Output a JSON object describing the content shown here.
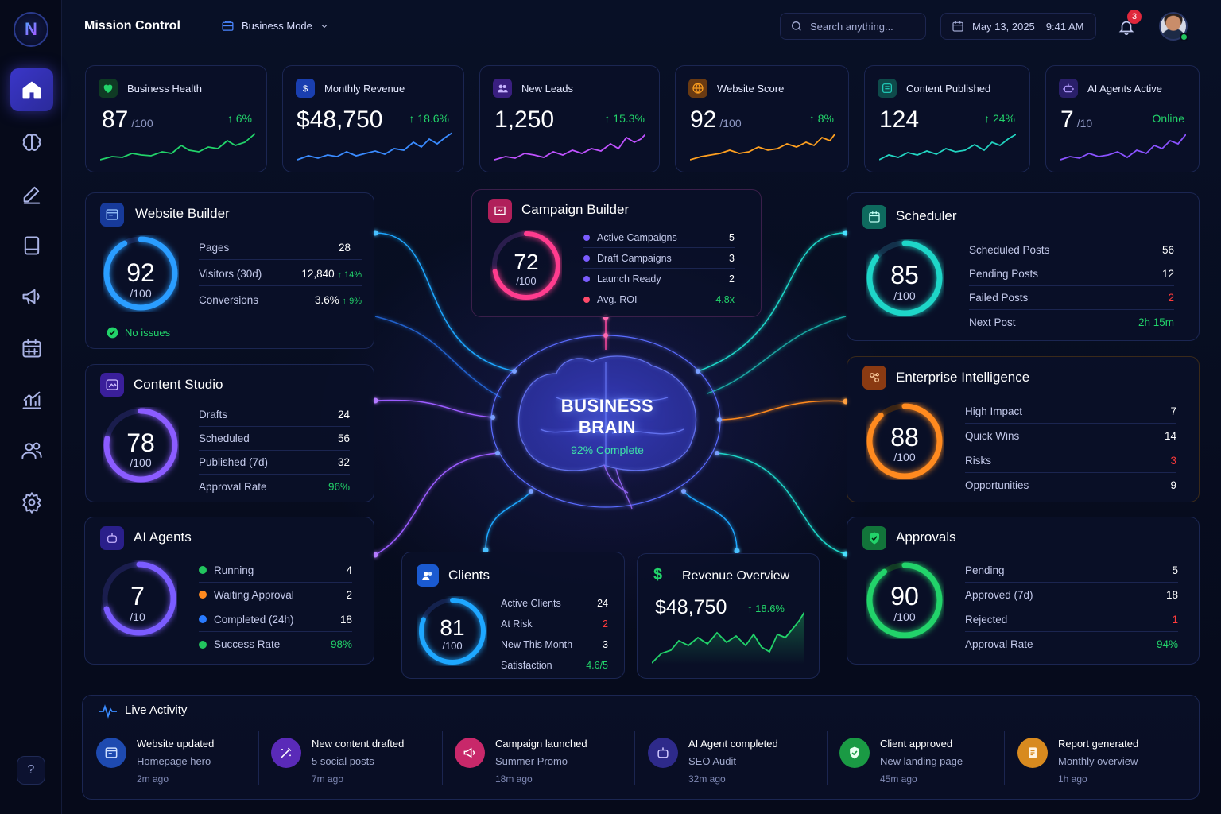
{
  "header": {
    "app_title": "Mission Control",
    "mode_label": "Business Mode",
    "search_placeholder": "Search anything...",
    "date": "May 13, 2025",
    "time": "9:41 AM",
    "notification_count": "3"
  },
  "sidebar": {
    "logo": "N",
    "items": [
      {
        "icon": "home-icon",
        "active": true
      },
      {
        "icon": "brain-icon"
      },
      {
        "icon": "pencil-icon"
      },
      {
        "icon": "document-icon"
      },
      {
        "icon": "megaphone-icon"
      },
      {
        "icon": "calendar-icon"
      },
      {
        "icon": "chart-icon"
      },
      {
        "icon": "users-icon"
      },
      {
        "icon": "settings-icon"
      }
    ],
    "help": "?"
  },
  "kpis": [
    {
      "label": "Business Health",
      "value": "87",
      "sub": "/100",
      "delta": "6%",
      "color": "#22d36a",
      "icon": "heart-icon"
    },
    {
      "label": "Monthly Revenue",
      "value": "$48,750",
      "sub": "",
      "delta": "18.6%",
      "color": "#3a8bff",
      "icon": "dollar-icon"
    },
    {
      "label": "New Leads",
      "value": "1,250",
      "sub": "",
      "delta": "15.3%",
      "color": "#c052ff",
      "icon": "users-icon"
    },
    {
      "label": "Website Score",
      "value": "92",
      "sub": "/100",
      "delta": "8%",
      "color": "#ffa020",
      "icon": "globe-icon"
    },
    {
      "label": "Content Published",
      "value": "124",
      "sub": "",
      "delta": "24%",
      "color": "#22d3c0",
      "icon": "document-icon"
    },
    {
      "label": "AI Agents Active",
      "value": "7",
      "sub": "/10",
      "delta": "Online",
      "color": "#8a52ff",
      "icon": "robot-icon"
    }
  ],
  "website_builder": {
    "title": "Website Builder",
    "score": "92",
    "sub": "/100",
    "score_fraction": 0.92,
    "color": "#2a9dff",
    "rows": [
      {
        "label": "Pages",
        "value": "28",
        "delta": ""
      },
      {
        "label": "Visitors (30d)",
        "value": "12,840",
        "delta": "14%"
      },
      {
        "label": "Conversions",
        "value": "3.6%",
        "delta": "9%"
      }
    ],
    "status": "No issues"
  },
  "content_studio": {
    "title": "Content Studio",
    "score": "78",
    "sub": "/100",
    "score_fraction": 0.78,
    "color": "#8b5cff",
    "rows": [
      {
        "label": "Drafts",
        "value": "24"
      },
      {
        "label": "Scheduled",
        "value": "56"
      },
      {
        "label": "Published (7d)",
        "value": "32"
      },
      {
        "label": "Approval Rate",
        "value": "96%"
      }
    ]
  },
  "ai_agents": {
    "title": "AI Agents",
    "score": "7",
    "sub": "/10",
    "score_fraction": 0.7,
    "color": "#7b5cff",
    "rows": [
      {
        "label": "Running",
        "value": "4",
        "dot": "#22c55e"
      },
      {
        "label": "Waiting Approval",
        "value": "2",
        "dot": "#ff8a1f"
      },
      {
        "label": "Completed (24h)",
        "value": "18",
        "dot": "#2a7bff"
      },
      {
        "label": "Success Rate",
        "value": "98%",
        "dot": "#22c55e"
      }
    ]
  },
  "campaign_builder": {
    "title": "Campaign Builder",
    "score": "72",
    "sub": "/100",
    "score_fraction": 0.72,
    "color": "#ff3c8e",
    "rows": [
      {
        "label": "Active Campaigns",
        "value": "5",
        "dot": "#7b5cff"
      },
      {
        "label": "Draft Campaigns",
        "value": "3",
        "dot": "#7b5cff"
      },
      {
        "label": "Launch Ready",
        "value": "2",
        "dot": "#7b5cff"
      },
      {
        "label": "Avg. ROI",
        "value": "4.8x",
        "dot": "#ff4a6a"
      }
    ]
  },
  "brain": {
    "line1": "BUSINESS",
    "line2": "BRAIN",
    "progress": "92% Complete"
  },
  "clients": {
    "title": "Clients",
    "score": "81",
    "sub": "/100",
    "score_fraction": 0.81,
    "color": "#1ea7ff",
    "rows": [
      {
        "label": "Active Clients",
        "value": "24"
      },
      {
        "label": "At Risk",
        "value": "2"
      },
      {
        "label": "New This Month",
        "value": "3"
      },
      {
        "label": "Satisfaction",
        "value": "4.6/5"
      }
    ]
  },
  "revenue_overview": {
    "title": "Revenue Overview",
    "value": "$48,750",
    "delta": "18.6%"
  },
  "scheduler": {
    "title": "Scheduler",
    "score": "85",
    "sub": "/100",
    "score_fraction": 0.85,
    "color": "#1ed6c8",
    "rows": [
      {
        "label": "Scheduled Posts",
        "value": "56"
      },
      {
        "label": "Pending Posts",
        "value": "12"
      },
      {
        "label": "Failed Posts",
        "value": "2"
      },
      {
        "label": "Next Post",
        "value": "2h 15m"
      }
    ]
  },
  "enterprise": {
    "title": "Enterprise Intelligence",
    "score": "88",
    "sub": "/100",
    "score_fraction": 0.88,
    "color": "#ff8a1f",
    "rows": [
      {
        "label": "High Impact",
        "value": "7"
      },
      {
        "label": "Quick Wins",
        "value": "14"
      },
      {
        "label": "Risks",
        "value": "3"
      },
      {
        "label": "Opportunities",
        "value": "9"
      }
    ]
  },
  "approvals": {
    "title": "Approvals",
    "score": "90",
    "sub": "/100",
    "score_fraction": 0.9,
    "color": "#22d36a",
    "rows": [
      {
        "label": "Pending",
        "value": "5"
      },
      {
        "label": "Approved (7d)",
        "value": "18"
      },
      {
        "label": "Rejected",
        "value": "1"
      },
      {
        "label": "Approval Rate",
        "value": "94%"
      }
    ]
  },
  "activity": {
    "title": "Live Activity",
    "items": [
      {
        "title": "Website updated",
        "sub": "Homepage hero",
        "time": "2m ago",
        "color": "#1e5fd8",
        "icon": "browser-icon"
      },
      {
        "title": "New content drafted",
        "sub": "5 social posts",
        "time": "7m ago",
        "color": "#6a2fd0",
        "icon": "magic-wand-icon"
      },
      {
        "title": "Campaign launched",
        "sub": "Summer Promo",
        "time": "18m ago",
        "color": "#d12a6a",
        "icon": "campaign-icon"
      },
      {
        "title": "AI Agent completed",
        "sub": "SEO Audit",
        "time": "32m ago",
        "color": "#3a2fa8",
        "icon": "robot-icon"
      },
      {
        "title": "Client approved",
        "sub": "New landing page",
        "time": "45m ago",
        "color": "#1aa84a",
        "icon": "shield-check-icon"
      },
      {
        "title": "Report generated",
        "sub": "Monthly overview",
        "time": "1h ago",
        "color": "#e08a1f",
        "icon": "report-icon"
      }
    ]
  }
}
